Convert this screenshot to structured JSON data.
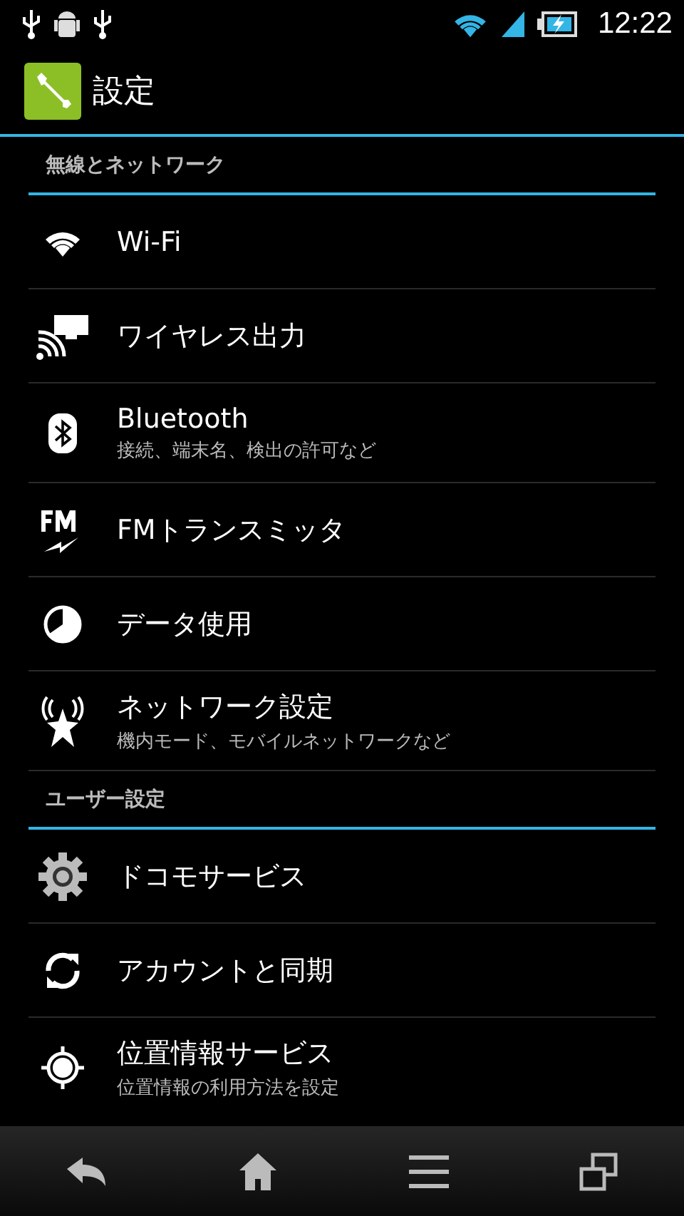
{
  "status_bar": {
    "time": "12:22"
  },
  "action_bar": {
    "title": "設定"
  },
  "sections": [
    {
      "header": "無線とネットワーク",
      "items": [
        {
          "kind": "wifi",
          "title": "Wi-Fi"
        },
        {
          "kind": "cast",
          "title": "ワイヤレス出力"
        },
        {
          "kind": "bluetooth",
          "title": "Bluetooth",
          "subtitle": "接続、端末名、検出の許可など"
        },
        {
          "kind": "fm",
          "title": "FMトランスミッタ"
        },
        {
          "kind": "data",
          "title": "データ使用"
        },
        {
          "kind": "antenna",
          "title": "ネットワーク設定",
          "subtitle": "機内モード、モバイルネットワークなど"
        }
      ]
    },
    {
      "header": "ユーザー設定",
      "items": [
        {
          "kind": "gear",
          "title": "ドコモサービス"
        },
        {
          "kind": "sync",
          "title": "アカウントと同期"
        },
        {
          "kind": "location",
          "title": "位置情報サービス",
          "subtitle": "位置情報の利用方法を設定"
        }
      ]
    }
  ]
}
